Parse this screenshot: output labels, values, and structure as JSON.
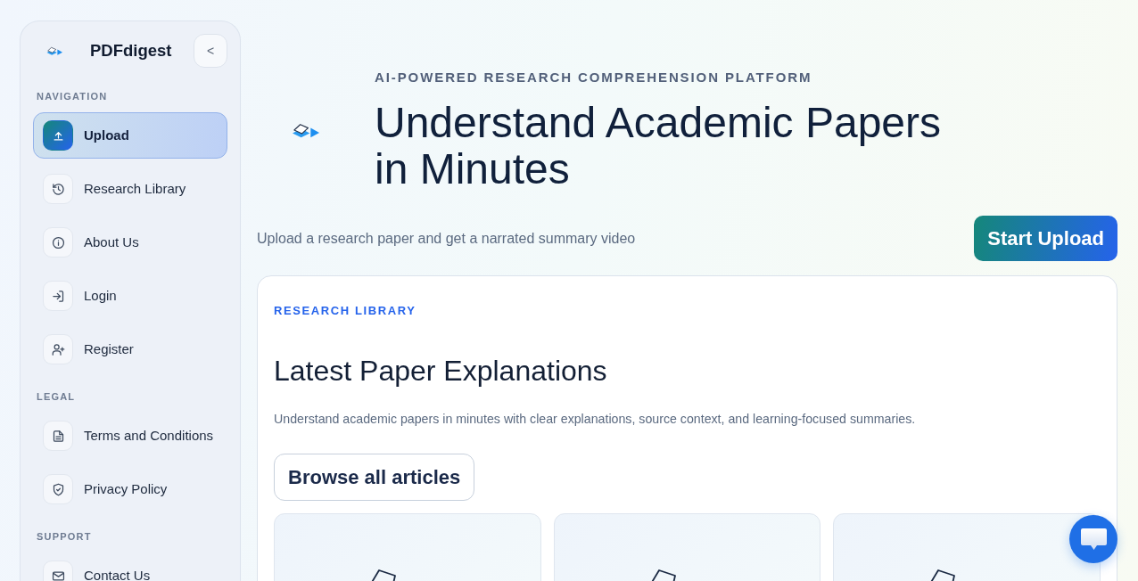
{
  "sidebar": {
    "brand": "PDFdigest",
    "collapse_button": "<",
    "sections": [
      {
        "title": "NAVIGATION",
        "items": [
          {
            "label": "Upload",
            "selected": true
          },
          {
            "label": "Research Library",
            "selected": false
          },
          {
            "label": "About Us",
            "selected": false
          },
          {
            "label": "Login",
            "selected": false
          },
          {
            "label": "Register",
            "selected": false
          }
        ]
      },
      {
        "title": "LEGAL",
        "items": [
          {
            "label": "Terms and Conditions",
            "selected": false
          },
          {
            "label": "Privacy Policy",
            "selected": false
          }
        ]
      },
      {
        "title": "SUPPORT",
        "items": [
          {
            "label": "Contact Us",
            "selected": false
          }
        ]
      }
    ]
  },
  "hero": {
    "eyebrow": "AI-POWERED RESEARCH COMPREHENSION PLATFORM",
    "title": "Understand Academic Papers in Minutes",
    "subtitle": "Upload a research paper and get a narrated summary video",
    "button": "Start Upload"
  },
  "library": {
    "eyebrow": "RESEARCH LIBRARY",
    "title": "Latest Paper Explanations",
    "description": "Understand academic papers in minutes with clear explanations, source context, and learning-focused summaries.",
    "button": "Browse all articles"
  }
}
